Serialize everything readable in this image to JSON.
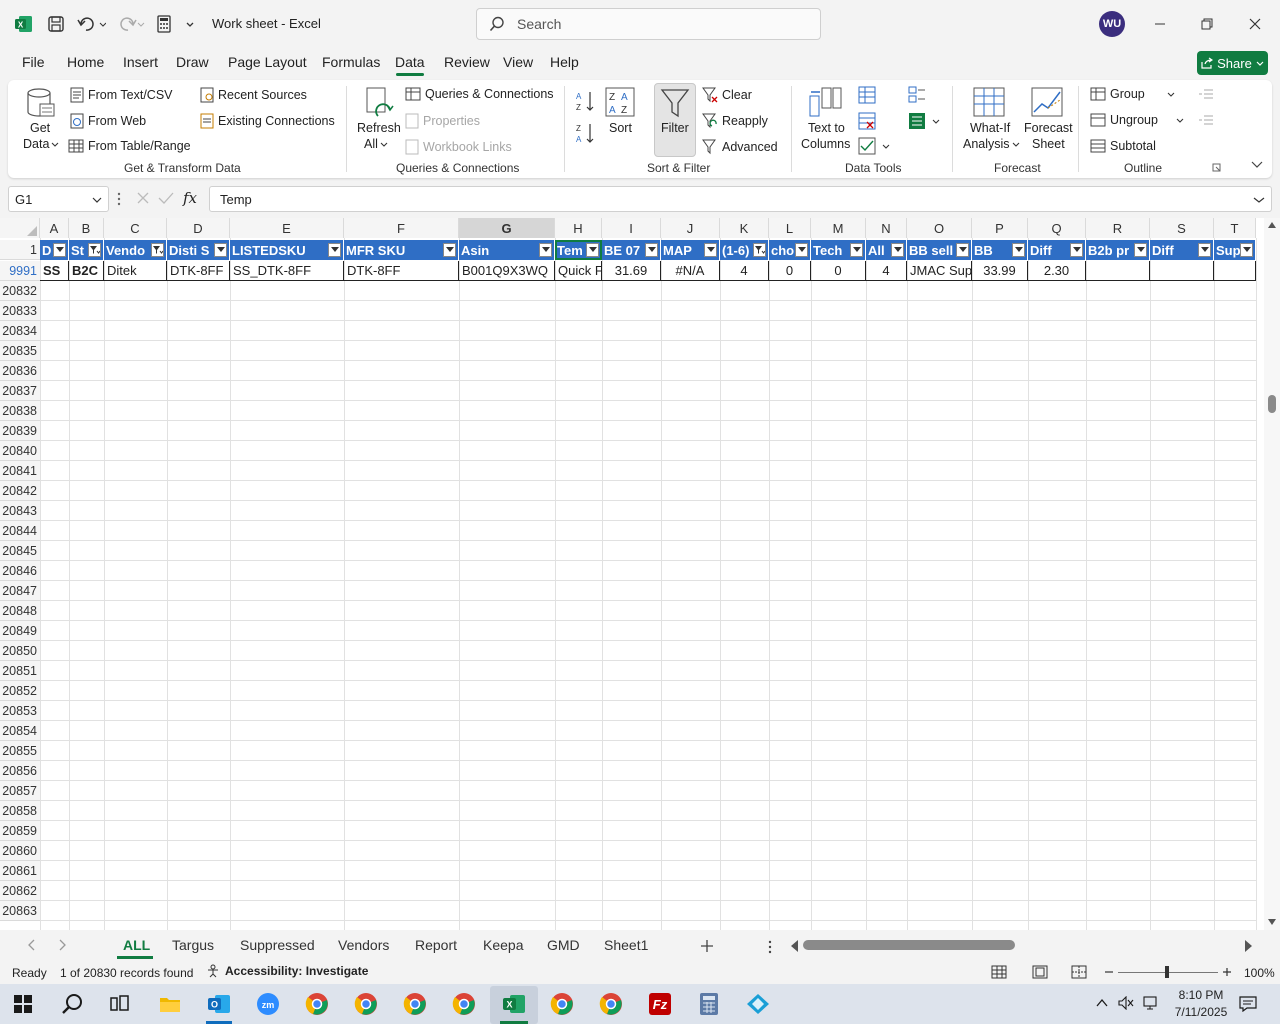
{
  "app": {
    "title": "Work sheet  -  Excel",
    "user_initials": "WU"
  },
  "search": {
    "placeholder": "Search"
  },
  "menu": [
    "File",
    "Home",
    "Insert",
    "Draw",
    "Page Layout",
    "Formulas",
    "Data",
    "Review",
    "View",
    "Help"
  ],
  "menu_active": "Data",
  "share_label": "Share",
  "ribbon": {
    "get_data": "Get\nData",
    "from_text_csv": "From Text/CSV",
    "from_web": "From Web",
    "from_table_range": "From Table/Range",
    "recent_sources": "Recent Sources",
    "existing_connections": "Existing Connections",
    "group_get_transform": "Get & Transform Data",
    "refresh_all": "Refresh",
    "refresh_all2": "All",
    "queries_connections": "Queries & Connections",
    "properties": "Properties",
    "workbook_links": "Workbook Links",
    "group_queries": "Queries & Connections",
    "sort": "Sort",
    "filter": "Filter",
    "clear": "Clear",
    "reapply": "Reapply",
    "advanced": "Advanced",
    "group_sort_filter": "Sort & Filter",
    "text_to_columns": "Text to",
    "text_to_columns2": "Columns",
    "group_data_tools": "Data Tools",
    "what_if": "What-If",
    "what_if2": "Analysis",
    "forecast_sheet": "Forecast",
    "forecast_sheet2": "Sheet",
    "group_forecast": "Forecast",
    "group": "Group",
    "ungroup": "Ungroup",
    "subtotal": "Subtotal",
    "group_outline": "Outline"
  },
  "namebox": "G1",
  "formula": "Temp",
  "columns": [
    "A",
    "B",
    "C",
    "D",
    "E",
    "F",
    "G",
    "H",
    "I",
    "J",
    "K",
    "L",
    "M",
    "N",
    "O",
    "P",
    "Q",
    "R",
    "S",
    "T"
  ],
  "header_row_number": "1",
  "headers": [
    "D",
    "St",
    "Vendo",
    "Disti S",
    "LISTEDSKU",
    "MFR SKU",
    "Asin",
    "Tem",
    "BE 07",
    "MAP",
    "(1-6)",
    "cho",
    "Tech",
    "All",
    "BB sell",
    "BB",
    "Diff",
    "B2b pr",
    "Diff",
    "Sup"
  ],
  "data_row_number": "9991",
  "data_row": [
    "SS",
    "B2C",
    "Ditek",
    "DTK-8FF",
    "SS_DTK-8FF",
    "DTK-8FF",
    "B001Q9X3WQ",
    "Quick F",
    "31.69",
    "#N/A",
    "4",
    "0",
    "0",
    "4",
    "JMAC Sup",
    "33.99",
    "2.30",
    "",
    "",
    ""
  ],
  "row_numbers": [
    "20832",
    "20833",
    "20834",
    "20835",
    "20836",
    "20837",
    "20838",
    "20839",
    "20840",
    "20841",
    "20842",
    "20843",
    "20844",
    "20845",
    "20846",
    "20847",
    "20848",
    "20849",
    "20850",
    "20851",
    "20852",
    "20853",
    "20854",
    "20855",
    "20856",
    "20857",
    "20858",
    "20859",
    "20860",
    "20861",
    "20862",
    "20863"
  ],
  "sheets": [
    "ALL",
    "Targus",
    "Suppressed",
    "Vendors",
    "Report",
    "Keepa",
    "GMD",
    "Sheet1"
  ],
  "active_sheet": "ALL",
  "status": {
    "ready": "Ready",
    "records": "1 of 20830 records found",
    "accessibility": "Accessibility: Investigate",
    "zoom": "100%"
  },
  "clock": {
    "time": "8:10 PM",
    "date": "7/11/2025"
  },
  "colors": {
    "excel_green": "#107c41",
    "header_blue": "#2f6ec5",
    "avatar": "#3b2e7e"
  }
}
